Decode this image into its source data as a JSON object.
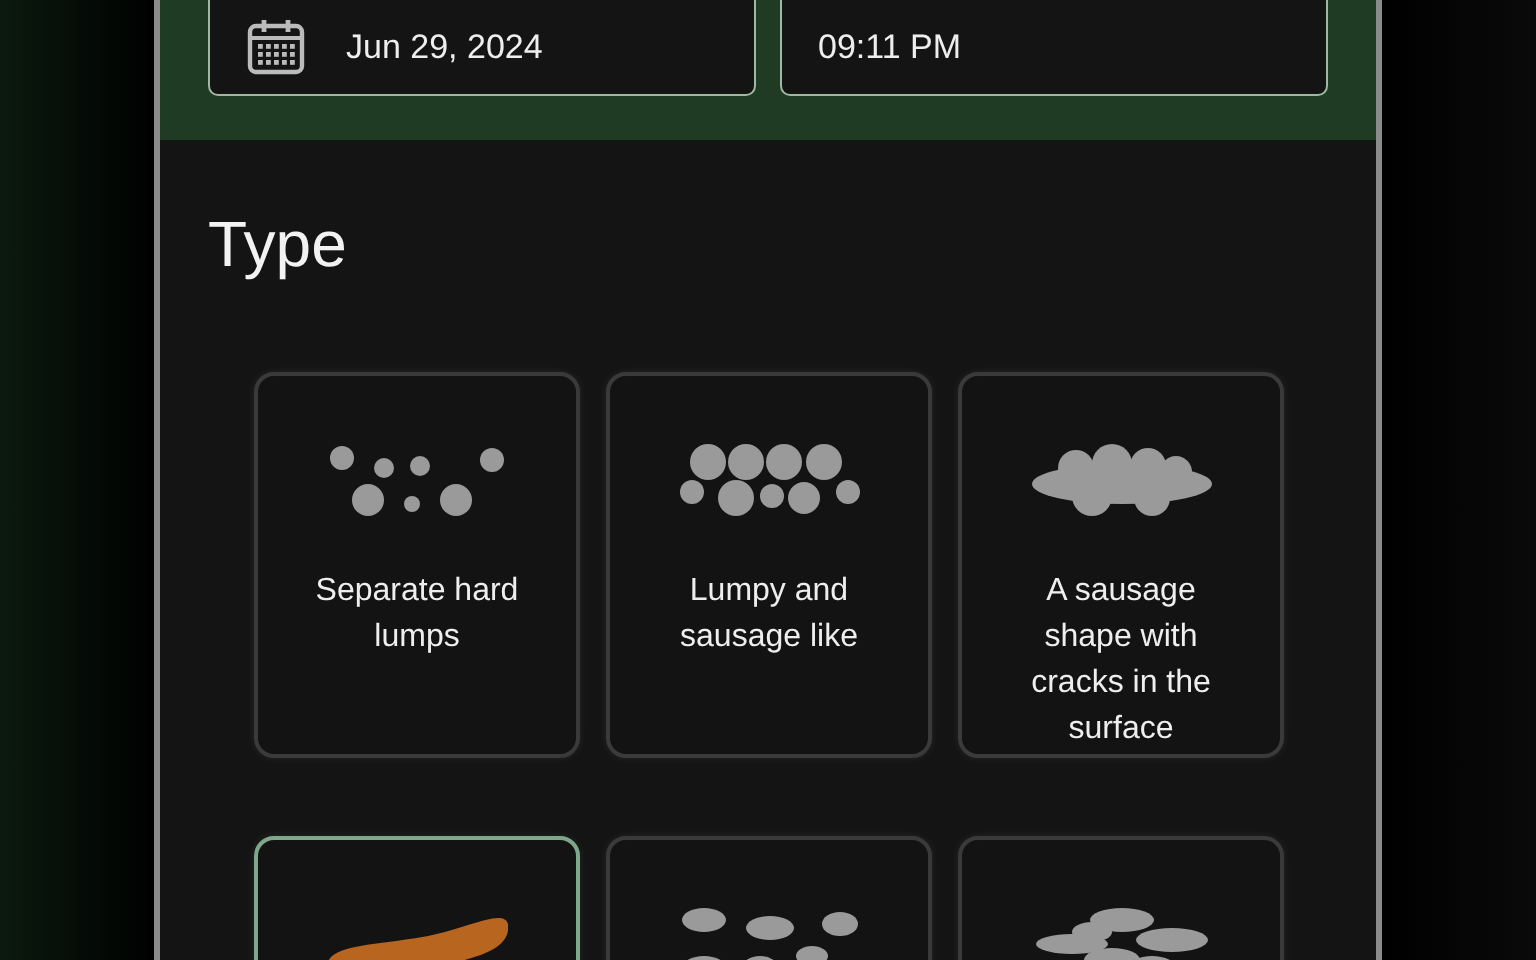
{
  "date_field": {
    "value": "Jun 29, 2024"
  },
  "time_field": {
    "value": "09:11 PM"
  },
  "section_title": "Type",
  "types": [
    {
      "kind": "separate-lumps",
      "label": "Separate hard lumps",
      "selected": false
    },
    {
      "kind": "lumpy",
      "label": "Lumpy and sausage like",
      "selected": false
    },
    {
      "kind": "cracked",
      "label": "A sausage shape with cracks in the surface",
      "selected": false
    },
    {
      "kind": "smooth",
      "selected": true
    },
    {
      "kind": "soft-blobs",
      "selected": false
    },
    {
      "kind": "fluffy",
      "selected": false
    }
  ]
}
